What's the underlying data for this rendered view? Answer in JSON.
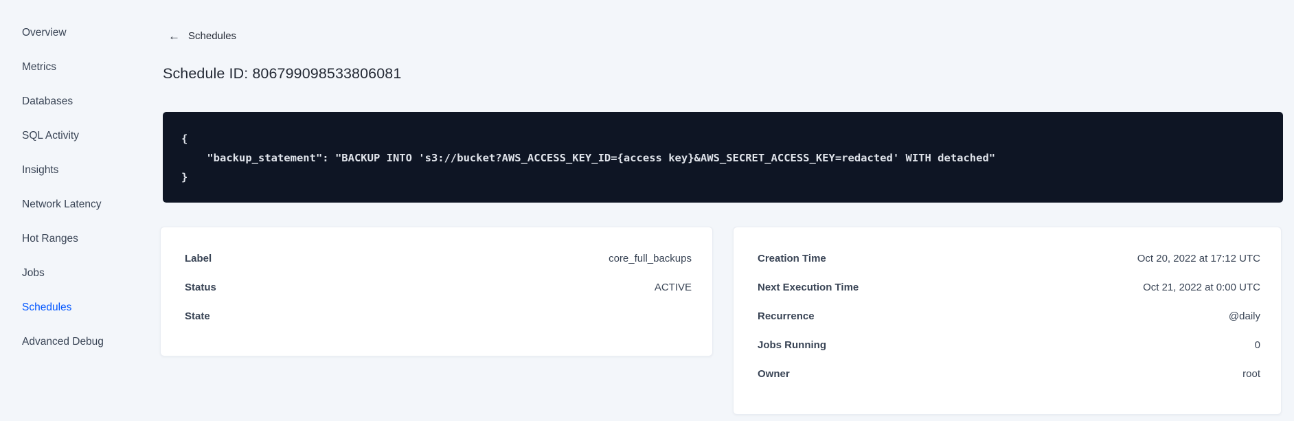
{
  "colors": {
    "background": "#f3f6fa",
    "text": "#394455",
    "accent": "#0055ff",
    "code_background": "#0e1524",
    "code_text": "#dfe3ea"
  },
  "sidebar": {
    "items": [
      {
        "label": "Overview",
        "active": false
      },
      {
        "label": "Metrics",
        "active": false
      },
      {
        "label": "Databases",
        "active": false
      },
      {
        "label": "SQL Activity",
        "active": false
      },
      {
        "label": "Insights",
        "active": false
      },
      {
        "label": "Network Latency",
        "active": false
      },
      {
        "label": "Hot Ranges",
        "active": false
      },
      {
        "label": "Jobs",
        "active": false
      },
      {
        "label": "Schedules",
        "active": true
      },
      {
        "label": "Advanced Debug",
        "active": false
      }
    ]
  },
  "header": {
    "back_icon": "←",
    "back_label": "Schedules",
    "title": "Schedule ID: 806799098533806081"
  },
  "code_block": {
    "lines": [
      "{",
      "    \"backup_statement\": \"BACKUP INTO 's3://bucket?AWS_ACCESS_KEY_ID={access key}&AWS_SECRET_ACCESS_KEY=redacted' WITH detached\"",
      "}"
    ]
  },
  "cards": {
    "left": {
      "rows": [
        {
          "label": "Label",
          "value": "core_full_backups"
        },
        {
          "label": "Status",
          "value": "ACTIVE"
        },
        {
          "label": "State",
          "value": ""
        }
      ]
    },
    "right": {
      "rows": [
        {
          "label": "Creation Time",
          "value": "Oct 20, 2022 at 17:12 UTC"
        },
        {
          "label": "Next Execution Time",
          "value": "Oct 21, 2022 at 0:00 UTC"
        },
        {
          "label": "Recurrence",
          "value": "@daily"
        },
        {
          "label": "Jobs Running",
          "value": "0"
        },
        {
          "label": "Owner",
          "value": "root"
        }
      ]
    }
  }
}
